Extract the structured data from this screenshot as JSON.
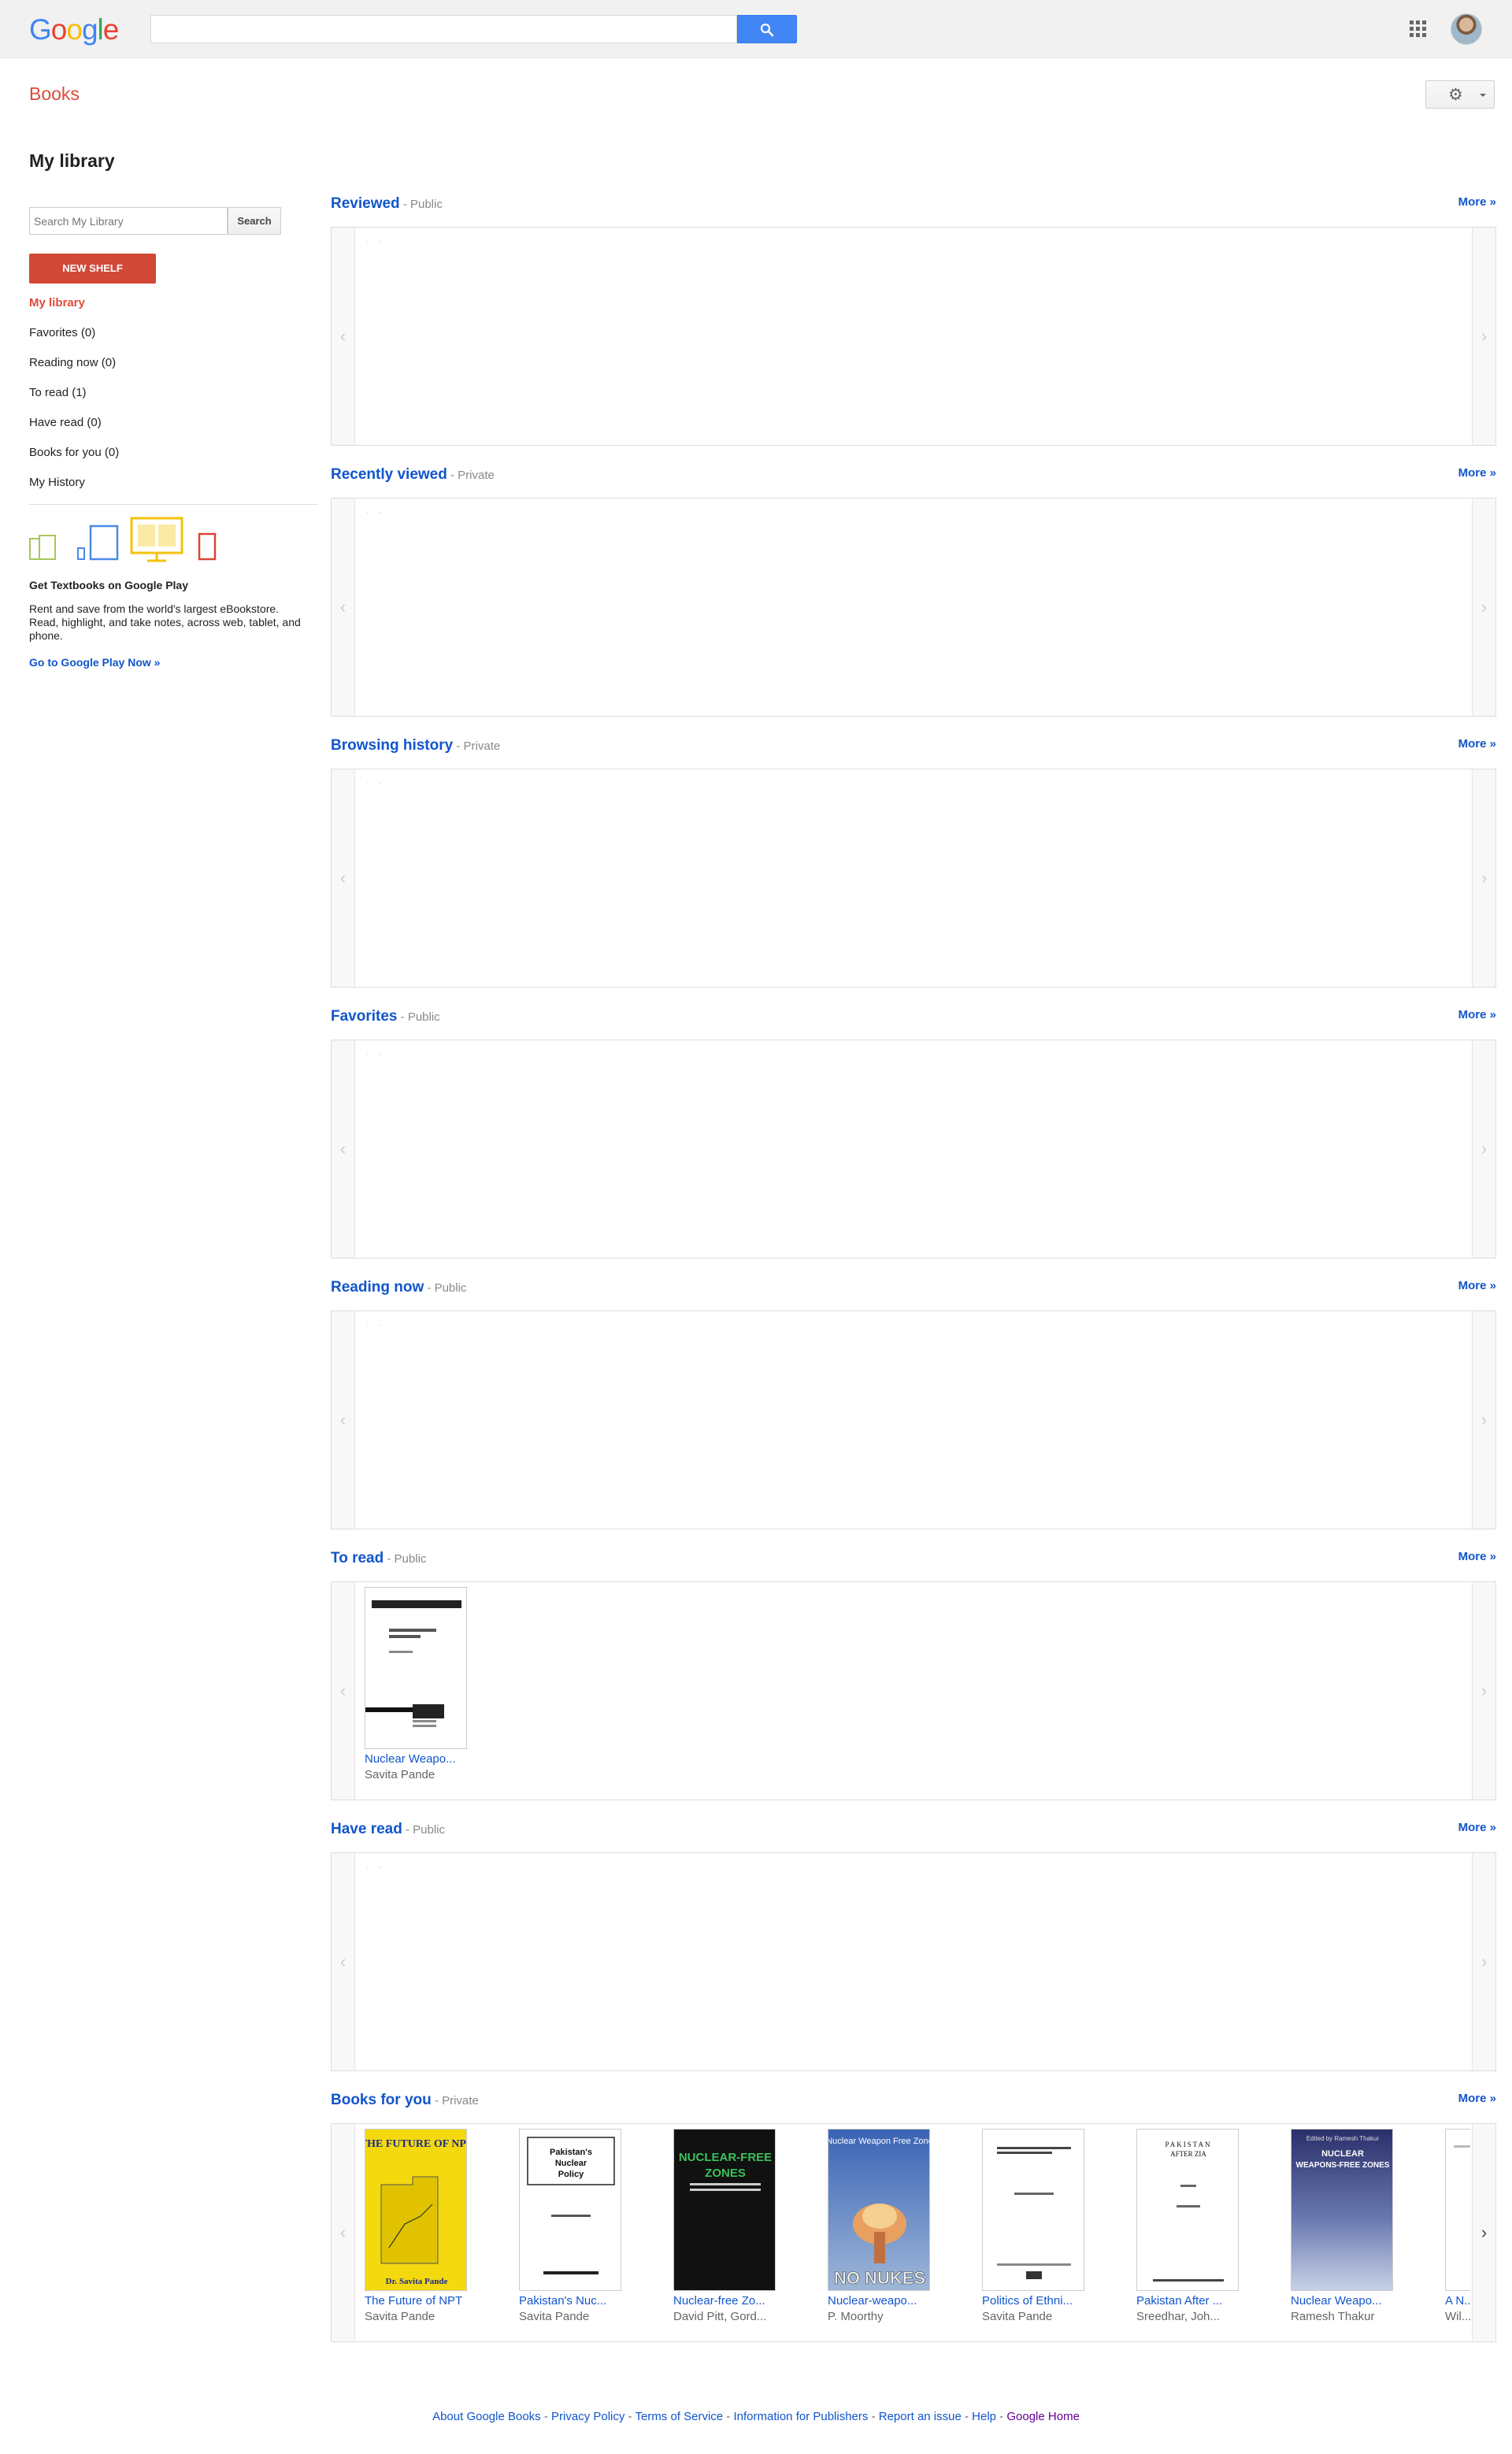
{
  "header": {
    "logo_letters": [
      {
        "ch": "G",
        "color": "#4285f4"
      },
      {
        "ch": "o",
        "color": "#ea4335"
      },
      {
        "ch": "o",
        "color": "#fbbc05"
      },
      {
        "ch": "g",
        "color": "#4285f4"
      },
      {
        "ch": "l",
        "color": "#34a853"
      },
      {
        "ch": "e",
        "color": "#ea4335"
      }
    ],
    "search_value": "",
    "search_icon": "search-icon",
    "apps_icon": "apps-grid-icon"
  },
  "subheader": {
    "section_title": "Books",
    "settings_icon": "gear-icon"
  },
  "page_title": "My library",
  "sidebar": {
    "search_placeholder": "Search My Library",
    "search_button": "Search",
    "new_shelf_button": "NEW SHELF",
    "nav": [
      {
        "label": "My library",
        "active": true
      },
      {
        "label": "Favorites (0)",
        "active": false
      },
      {
        "label": "Reading now (0)",
        "active": false
      },
      {
        "label": "To read (1)",
        "active": false
      },
      {
        "label": "Have read (0)",
        "active": false
      },
      {
        "label": "Books for you (0)",
        "active": false
      },
      {
        "label": "My History",
        "active": false
      }
    ],
    "promo": {
      "title": "Get Textbooks on Google Play",
      "text": "Rent and save from the world's largest eBookstore. Read, highlight, and take notes, across web, tablet, and phone.",
      "link": "Go to Google Play Now »"
    }
  },
  "shelves": [
    {
      "title": "Reviewed",
      "privacy": " - Public",
      "more": "More »",
      "books": []
    },
    {
      "title": "Recently viewed",
      "privacy": " - Private",
      "more": "More »",
      "books": []
    },
    {
      "title": "Browsing history",
      "privacy": " - Private",
      "more": "More »",
      "books": []
    },
    {
      "title": "Favorites",
      "privacy": " - Public",
      "more": "More »",
      "books": []
    },
    {
      "title": "Reading now",
      "privacy": " - Public",
      "more": "More »",
      "books": []
    },
    {
      "title": "To read",
      "privacy": " - Public",
      "more": "More »",
      "books": [
        {
          "title": "Nuclear Weapo...",
          "author": "Savita Pande",
          "cover_style": "white-doc"
        }
      ]
    },
    {
      "title": "Have read",
      "privacy": " - Public",
      "more": "More »",
      "books": []
    },
    {
      "title": "Books for you",
      "privacy": " - Private",
      "more": "More »",
      "books": [
        {
          "title": "The Future of NPT",
          "author": "Savita Pande",
          "cover_style": "yellow-chart"
        },
        {
          "title": "Pakistan's Nuc...",
          "author": "Savita Pande",
          "cover_style": "white-title"
        },
        {
          "title": "Nuclear-free Zo...",
          "author": "David Pitt, Gord...",
          "cover_style": "black-green"
        },
        {
          "title": "Nuclear-weapo...",
          "author": "P. Moorthy",
          "cover_style": "blue-explosion"
        },
        {
          "title": "Politics of Ethni...",
          "author": "Savita Pande",
          "cover_style": "white-plain"
        },
        {
          "title": "Pakistan After ...",
          "author": "Sreedhar, Joh...",
          "cover_style": "white-text"
        },
        {
          "title": "Nuclear Weapo...",
          "author": "Ramesh Thakur",
          "cover_style": "navy-sky"
        },
        {
          "title": "A N...",
          "author": "Wil...",
          "cover_style": "partial"
        }
      ]
    }
  ],
  "footer": {
    "links": [
      "About Google Books",
      "Privacy Policy",
      "Terms of Service",
      "Information for Publishers",
      "Report an issue",
      "Help",
      "Google Home"
    ],
    "separator": " - "
  }
}
